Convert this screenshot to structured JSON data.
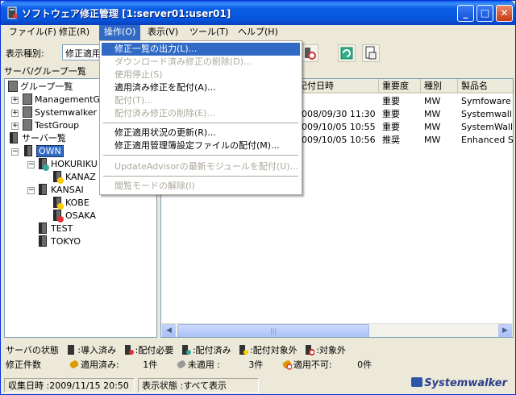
{
  "window": {
    "title": "ソフトウェア修正管理 [1:server01:user01]"
  },
  "menubar": {
    "items": [
      "ファイル(F)",
      "修正(R)",
      "操作(O)",
      "表示(V)",
      "ツール(T)",
      "ヘルプ(H)"
    ],
    "active_index": 2
  },
  "toolbar": {
    "label": "表示種別:",
    "select_value": "修正適用"
  },
  "left_header": "サーバ/グループ一覧",
  "tree": {
    "groups_root": "グループ一覧",
    "groups": [
      "ManagementGr",
      "Systemwalker",
      "TestGroup"
    ],
    "servers_root": "サーバ一覧",
    "own": "OWN",
    "hokuriku": "HOKURIKU",
    "kanazawa": "KANAZ",
    "kansai": "KANSAI",
    "kobe": "KOBE",
    "osaka": "OSAKA",
    "test": "TEST",
    "tokyo": "TOKYO"
  },
  "table": {
    "columns": [
      "配付日時",
      "重要度",
      "種別",
      "製品名"
    ],
    "rows": [
      [
        "",
        "重要",
        "MW",
        "Symfoware"
      ],
      [
        "2008/09/30 11:30",
        "重要",
        "MW",
        "Systemwall"
      ],
      [
        "2009/10/05 10:55",
        "重要",
        "MW",
        "SystemWall"
      ],
      [
        "2009/10/05 10:56",
        "推奨",
        "MW",
        "Enhanced S"
      ]
    ],
    "visible_date_fragments": [
      "記付日時",
      "008/09/30 11:30",
      "009/10/05 10:55",
      "009/10/05 10:56"
    ]
  },
  "operation_menu": {
    "items": [
      {
        "label": "修正一覧の出力(L)...",
        "disabled": false,
        "highlight": true
      },
      {
        "label": "ダウンロード済み修正の削除(D)...",
        "disabled": true
      },
      {
        "label": "使用停止(S)",
        "disabled": true
      },
      {
        "label": "適用済み修正を配付(A)...",
        "disabled": false
      },
      {
        "label": "配付(T)...",
        "disabled": true
      },
      {
        "label": "配付済み修正の削除(E)...",
        "disabled": true
      },
      {
        "sep": true
      },
      {
        "label": "修正適用状況の更新(R)...",
        "disabled": false
      },
      {
        "label": "修正適用管理簿設定ファイルの配付(M)...",
        "disabled": false
      },
      {
        "sep": true
      },
      {
        "label": "UpdateAdvisorの最新モジュールを配付(U)...",
        "disabled": true
      },
      {
        "sep": true
      },
      {
        "label": "閲覧モードの解除(I)",
        "disabled": true
      }
    ]
  },
  "legend": {
    "server_state_label": "サーバの状態",
    "states": [
      ":導入済み",
      ":配付必要",
      ":配付済み",
      ":配付対象外",
      ":対象外"
    ],
    "patch_count_label": "修正件数",
    "applied": "適用済み:",
    "applied_count": "1件",
    "not_applied": "未適用 :",
    "not_applied_count": "3件",
    "not_applicable": "適用不可:",
    "not_applicable_count": "0件"
  },
  "status": {
    "collected": "収集日時 :2009/11/15 20:50",
    "display_state": "表示状態 :すべて表示",
    "brand": "Systemwalker"
  },
  "colors": {
    "title_blue": "#0a5fe6",
    "highlight": "#316ac5",
    "disabled": "#aca899"
  }
}
